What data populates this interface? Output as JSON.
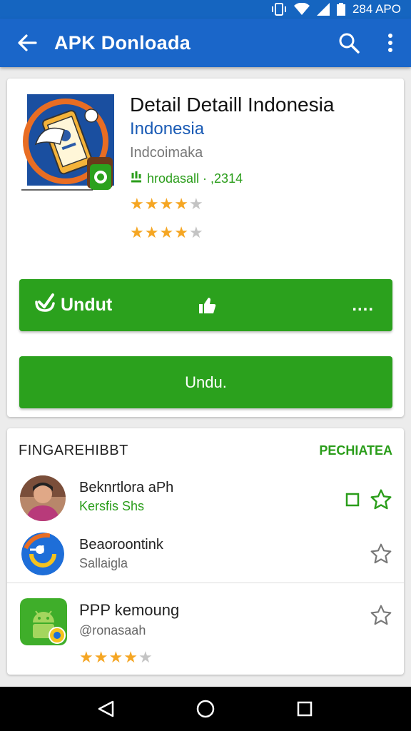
{
  "status_bar": {
    "time": "284 APO"
  },
  "app_bar": {
    "title": "APK Donloada"
  },
  "app": {
    "name": "Detail Detaill Indonesia",
    "developer": "Indonesia",
    "category": "Indcoimaka",
    "meta": "hrodasall · ,2314",
    "rating_1": 4,
    "rating_2": 4,
    "max_rating": 5
  },
  "buttons": {
    "primary_label": "Undut",
    "more_label": "....",
    "secondary_label": "Undu."
  },
  "section": {
    "heading": "FINGAREHIBBT",
    "action": "PECHIATEA",
    "items": [
      {
        "title": "Beknrtlora aPh",
        "subtitle": "Kersfis Shs"
      },
      {
        "title": "Beaoroontink",
        "subtitle": "Sallaigla"
      },
      {
        "title": "PPP kemoung",
        "subtitle": "@ronasaah",
        "rating": 4
      }
    ]
  },
  "colors": {
    "primary": "#1a66c9",
    "accent_green": "#2ba11d",
    "star": "#f5a623"
  },
  "icons": {
    "back": "arrow-back-icon",
    "search": "search-icon",
    "overflow": "more-vert-icon",
    "download": "download-check-icon",
    "thumb": "thumb-up-icon",
    "favorite": "star-outline-icon"
  }
}
